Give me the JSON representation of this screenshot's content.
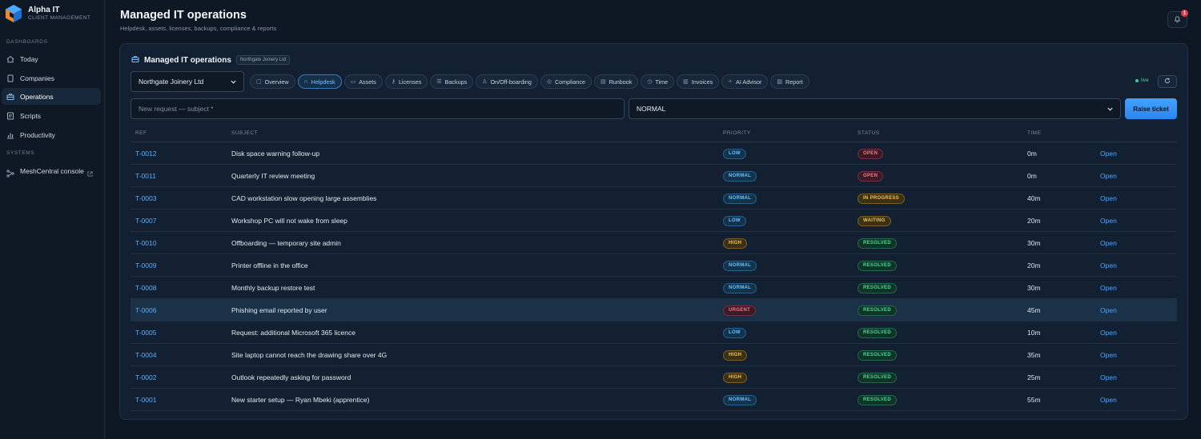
{
  "brand": {
    "name": "Alpha IT",
    "subtitle": "CLIENT MANAGEMENT"
  },
  "sidebar": {
    "dashboards_label": "DASHBOARDS",
    "items": [
      {
        "label": "Today",
        "icon": "home-icon"
      },
      {
        "label": "Companies",
        "icon": "document-icon"
      },
      {
        "label": "Operations",
        "icon": "briefcase-icon",
        "active": true
      },
      {
        "label": "Scripts",
        "icon": "script-icon"
      },
      {
        "label": "Productivity",
        "icon": "bar-chart-icon"
      }
    ],
    "systems_label": "SYSTEMS",
    "mesh": {
      "label": "MeshCentral console",
      "icon": "network-icon"
    }
  },
  "header": {
    "title": "Managed IT operations",
    "subtitle": "Helpdesk, assets, licenses, backups, compliance & reports",
    "notifications_count": "1"
  },
  "panel": {
    "title": "Managed IT operations",
    "company_tag": "Northgate Joinery Ltd",
    "company_select": "Northgate Joinery Ltd",
    "tabs": [
      {
        "label": "Overview",
        "icon": "overview-icon"
      },
      {
        "label": "Helpdesk",
        "icon": "headset-icon",
        "active": true
      },
      {
        "label": "Assets",
        "icon": "monitor-icon"
      },
      {
        "label": "Licenses",
        "icon": "key-icon"
      },
      {
        "label": "Backups",
        "icon": "database-icon"
      },
      {
        "label": "On/Off-boarding",
        "icon": "user-icon"
      },
      {
        "label": "Compliance",
        "icon": "shield-icon"
      },
      {
        "label": "Runbook",
        "icon": "book-icon"
      },
      {
        "label": "Time",
        "icon": "clock-icon"
      },
      {
        "label": "Invoices",
        "icon": "invoice-icon"
      },
      {
        "label": "AI Advisor",
        "icon": "sparkle-icon"
      },
      {
        "label": "Report",
        "icon": "report-icon"
      }
    ],
    "live_label": "live",
    "new_request_placeholder": "New request — subject *",
    "priority_select": "NORMAL",
    "raise_button": "Raise ticket"
  },
  "table": {
    "headers": {
      "ref": "REF",
      "subject": "SUBJECT",
      "priority": "PRIORITY",
      "status": "STATUS",
      "time": "TIME"
    },
    "open_label": "Open",
    "rows": [
      {
        "ref": "T-0012",
        "subject": "Disk space warning follow-up",
        "priority": "LOW",
        "status": "OPEN",
        "time": "0m"
      },
      {
        "ref": "T-0011",
        "subject": "Quarterly IT review meeting",
        "priority": "NORMAL",
        "status": "OPEN",
        "time": "0m"
      },
      {
        "ref": "T-0003",
        "subject": "CAD workstation slow opening large assemblies",
        "priority": "NORMAL",
        "status": "IN PROGRESS",
        "time": "40m"
      },
      {
        "ref": "T-0007",
        "subject": "Workshop PC will not wake from sleep",
        "priority": "LOW",
        "status": "WAITING",
        "time": "20m"
      },
      {
        "ref": "T-0010",
        "subject": "Offboarding — temporary site admin",
        "priority": "HIGH",
        "status": "RESOLVED",
        "time": "30m"
      },
      {
        "ref": "T-0009",
        "subject": "Printer offline in the office",
        "priority": "NORMAL",
        "status": "RESOLVED",
        "time": "20m"
      },
      {
        "ref": "T-0008",
        "subject": "Monthly backup restore test",
        "priority": "NORMAL",
        "status": "RESOLVED",
        "time": "30m"
      },
      {
        "ref": "T-0006",
        "subject": "Phishing email reported by user",
        "priority": "URGENT",
        "status": "RESOLVED",
        "time": "45m",
        "highlight": true
      },
      {
        "ref": "T-0005",
        "subject": "Request: additional Microsoft 365 licence",
        "priority": "LOW",
        "status": "RESOLVED",
        "time": "10m"
      },
      {
        "ref": "T-0004",
        "subject": "Site laptop cannot reach the drawing share over 4G",
        "priority": "HIGH",
        "status": "RESOLVED",
        "time": "35m"
      },
      {
        "ref": "T-0002",
        "subject": "Outlook repeatedly asking for password",
        "priority": "HIGH",
        "status": "RESOLVED",
        "time": "25m"
      },
      {
        "ref": "T-0001",
        "subject": "New starter setup — Ryan Mbeki (apprentice)",
        "priority": "NORMAL",
        "status": "RESOLVED",
        "time": "55m"
      }
    ]
  },
  "colors": {
    "background": "#0e1724",
    "panel": "#132031",
    "accent": "#2a86f0",
    "link": "#4ea6ff"
  }
}
